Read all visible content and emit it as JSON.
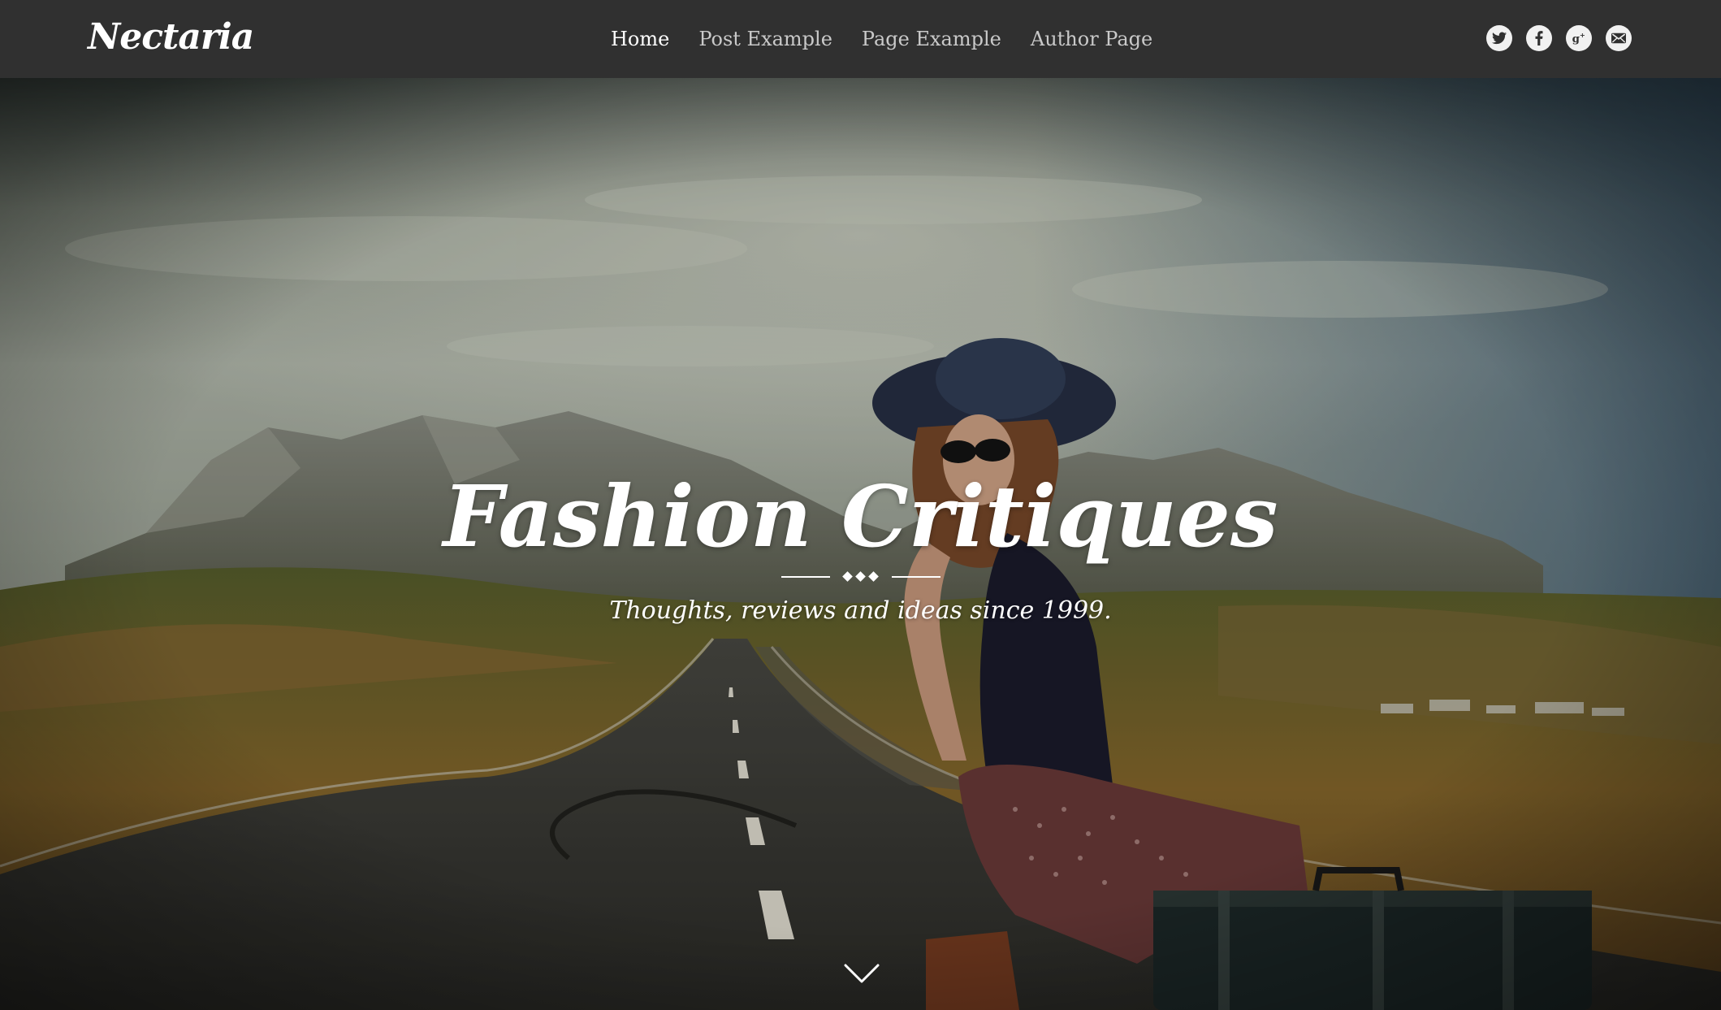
{
  "header": {
    "logo_text": "Nectaria",
    "nav": [
      {
        "label": "Home",
        "active": true
      },
      {
        "label": "Post Example",
        "active": false
      },
      {
        "label": "Page Example",
        "active": false
      },
      {
        "label": "Author Page",
        "active": false
      }
    ],
    "social_icons": [
      "twitter-icon",
      "facebook-icon",
      "google-plus-icon",
      "email-icon"
    ]
  },
  "hero": {
    "title": "Fashion Critiques",
    "subtitle": "Thoughts, reviews and ideas since 1999.",
    "scroll_icon": "chevron-down-icon"
  },
  "colors": {
    "header_bg": "#303030",
    "nav_text": "#c9c9c9",
    "nav_active": "#ffffff",
    "icon_bg": "#f1f1f1"
  }
}
